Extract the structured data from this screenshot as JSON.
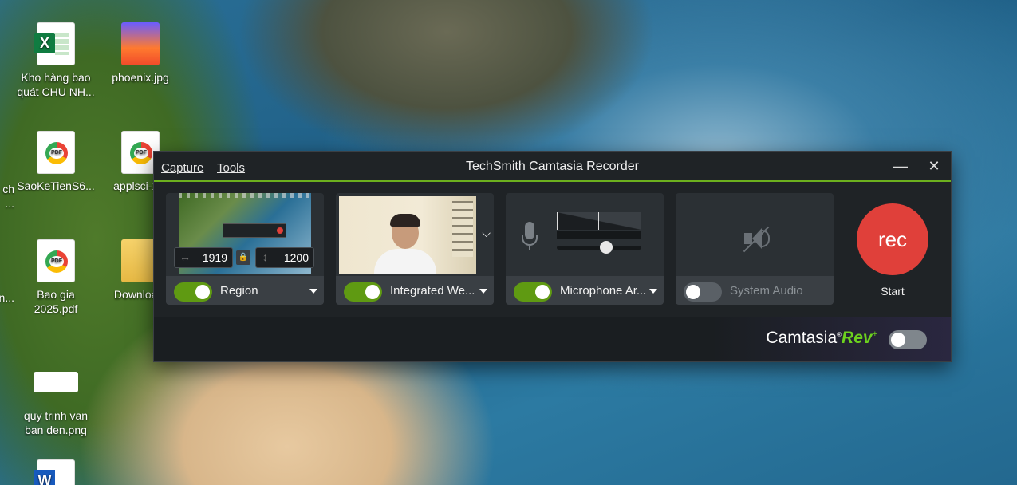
{
  "desktop": {
    "icons": [
      {
        "label": "Kho hàng bao quát CHU NH...",
        "type": "excel-file-icon"
      },
      {
        "label": "phoenix.jpg",
        "type": "image-file-icon"
      },
      {
        "label": "SaoKeTienS6...",
        "type": "pdf-file-icon"
      },
      {
        "label": "applsci-1...",
        "type": "pdf-file-icon"
      },
      {
        "label": "Bao gia 2025.pdf",
        "type": "pdf-file-icon"
      },
      {
        "label": "Downloa...",
        "type": "folder-icon"
      },
      {
        "label": "quy trinh van ban den.png",
        "type": "image-file-icon"
      },
      {
        "label": "",
        "type": "word-file-icon"
      }
    ],
    "edge_fragments": [
      "ch",
      "...",
      "n..."
    ]
  },
  "recorder": {
    "title": "TechSmith Camtasia Recorder",
    "menu": {
      "capture": "Capture",
      "tools": "Tools"
    },
    "window_buttons": {
      "minimize": "—",
      "close": "✕"
    },
    "region": {
      "label": "Region",
      "width": "1919",
      "height": "1200",
      "enabled": true
    },
    "webcam": {
      "label": "Integrated We...",
      "enabled": true
    },
    "microphone": {
      "label": "Microphone Ar...",
      "enabled": true,
      "level": 0.55
    },
    "system_audio": {
      "label": "System Audio",
      "enabled": false
    },
    "start": {
      "button_text": "rec",
      "label": "Start"
    },
    "brand": {
      "name": "Camtasia",
      "rev": "Rev",
      "rev_enabled": false
    }
  },
  "colors": {
    "accent": "#6cb01e",
    "rec": "#e0403a",
    "panel": "#2b3034"
  }
}
